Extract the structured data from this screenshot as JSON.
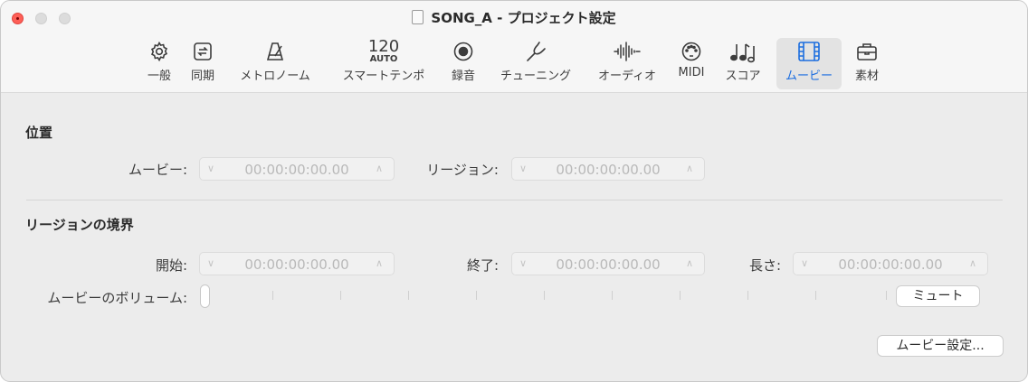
{
  "window": {
    "title": "SONG_A - プロジェクト設定"
  },
  "tabs": [
    {
      "label": "一般",
      "icon": "gear-icon"
    },
    {
      "label": "同期",
      "icon": "sync-icon"
    },
    {
      "label": "メトロノーム",
      "icon": "metronome-icon"
    },
    {
      "label": "スマートテンポ",
      "icon": "tempo-display",
      "tempo_value": "120",
      "tempo_mode": "AUTO"
    },
    {
      "label": "録音",
      "icon": "record-icon"
    },
    {
      "label": "チューニング",
      "icon": "tuning-fork-icon"
    },
    {
      "label": "オーディオ",
      "icon": "waveform-icon"
    },
    {
      "label": "MIDI",
      "icon": "midi-port-icon"
    },
    {
      "label": "スコア",
      "icon": "notes-icon"
    },
    {
      "label": "ムービー",
      "icon": "film-icon",
      "selected": true
    },
    {
      "label": "素材",
      "icon": "briefcase-icon"
    }
  ],
  "position": {
    "heading": "位置",
    "movie_label": "ムービー:",
    "movie_value": "00:00:00:00.00",
    "region_label": "リージョン:",
    "region_value": "00:00:00:00.00"
  },
  "region_bounds": {
    "heading": "リージョンの境界",
    "start_label": "開始:",
    "start_value": "00:00:00:00.00",
    "end_label": "終了:",
    "end_value": "00:00:00:00.00",
    "length_label": "長さ:",
    "length_value": "00:00:00:00.00"
  },
  "volume": {
    "label": "ムービーのボリューム:",
    "level": 0,
    "mute_label": "ミュート"
  },
  "movie_settings_button": "ムービー設定...",
  "colors": {
    "accent": "#1c6ee0",
    "close": "#fe5f57"
  }
}
